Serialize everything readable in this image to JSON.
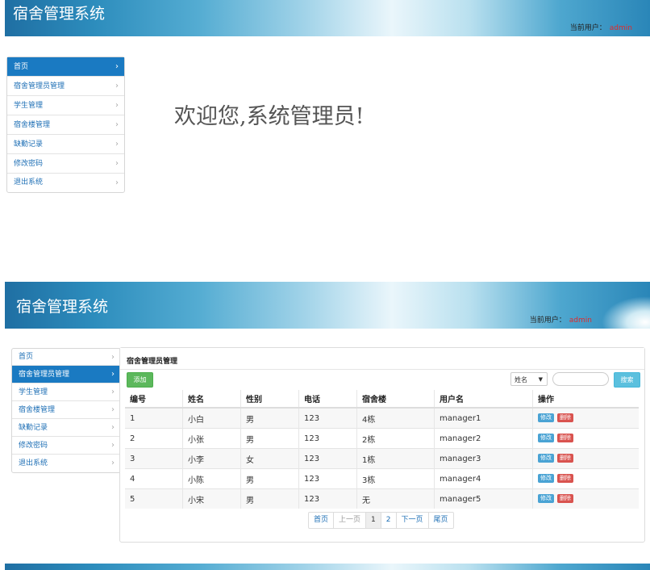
{
  "app_title": "宿舍管理系统",
  "current_user": {
    "label": "当前用户：",
    "name": "admin"
  },
  "menu": [
    {
      "label": "首页"
    },
    {
      "label": "宿舍管理员管理"
    },
    {
      "label": "学生管理"
    },
    {
      "label": "宿舍楼管理"
    },
    {
      "label": "缺勤记录"
    },
    {
      "label": "修改密码"
    },
    {
      "label": "退出系统"
    }
  ],
  "home": {
    "welcome": "欢迎您,系统管理员!"
  },
  "manager_page": {
    "heading": "宿舍管理员管理",
    "add_label": "添加",
    "search_select": "姓名",
    "search_value": "",
    "search_label": "搜索",
    "columns": [
      "编号",
      "姓名",
      "性别",
      "电话",
      "宿舍楼",
      "用户名",
      "操作"
    ],
    "rows": [
      {
        "id": "1",
        "name": "小白",
        "gender": "男",
        "phone": "123",
        "building": "4栋",
        "username": "manager1"
      },
      {
        "id": "2",
        "name": "小张",
        "gender": "男",
        "phone": "123",
        "building": "2栋",
        "username": "manager2"
      },
      {
        "id": "3",
        "name": "小李",
        "gender": "女",
        "phone": "123",
        "building": "1栋",
        "username": "manager3"
      },
      {
        "id": "4",
        "name": "小陈",
        "gender": "男",
        "phone": "123",
        "building": "3栋",
        "username": "manager4"
      },
      {
        "id": "5",
        "name": "小宋",
        "gender": "男",
        "phone": "123",
        "building": "无",
        "username": "manager5"
      }
    ],
    "edit_label": "修改",
    "delete_label": "删除",
    "pager": [
      "首页",
      "上一页",
      "1",
      "2",
      "下一页",
      "尾页"
    ]
  }
}
